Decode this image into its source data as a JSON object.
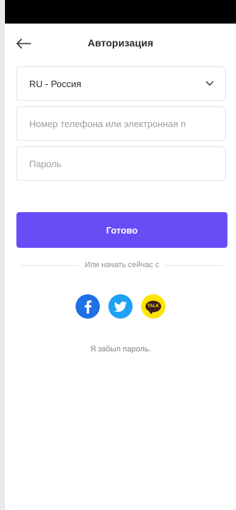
{
  "header": {
    "title": "Авторизация"
  },
  "form": {
    "country": {
      "selected": "RU - Россия"
    },
    "login": {
      "placeholder": "Номер телефона или электронная п",
      "value": ""
    },
    "password": {
      "placeholder": "Пароль",
      "value": ""
    },
    "submit_label": "Готово"
  },
  "alt_login": {
    "divider_text": "Или начать сейчас с",
    "providers": [
      {
        "name": "facebook",
        "icon": "facebook-icon",
        "color": "#1f6fe6"
      },
      {
        "name": "twitter",
        "icon": "twitter-icon",
        "color": "#1da1f2"
      },
      {
        "name": "kakaotalk",
        "icon": "kakaotalk-icon",
        "color": "#fde500",
        "label": "TALK"
      }
    ]
  },
  "forgot_password": "Я забыл пароль.",
  "colors": {
    "primary": "#6a4cf6",
    "status_bar": "#000000",
    "border": "#e3e4e8"
  }
}
